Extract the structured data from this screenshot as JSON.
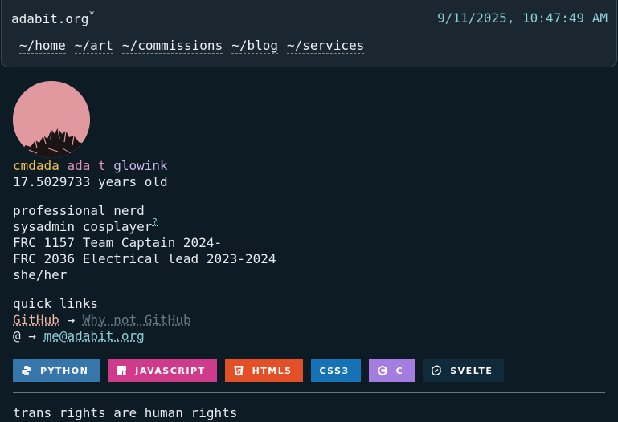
{
  "header": {
    "site_title": "adabit.org",
    "title_star": "*",
    "clock": "9/11/2025, 10:47:49 AM",
    "nav": [
      {
        "label": "~/home"
      },
      {
        "label": "~/art"
      },
      {
        "label": "~/commissions"
      },
      {
        "label": "~/blog"
      },
      {
        "label": "~/services"
      }
    ]
  },
  "profile": {
    "names": [
      "cmdada",
      "ada t",
      "glowink"
    ],
    "age": "17.5029733 years old",
    "bio": [
      "professional nerd",
      "sysadmin cosplayer",
      "FRC 1157 Team Captain 2024-",
      "FRC 2036 Electrical lead 2023-2024",
      "she/her"
    ],
    "bio_footnote": "?"
  },
  "quick_links": {
    "heading": "quick links",
    "github_label": "GitHub",
    "arrow": "→",
    "why_not_github": "Why not GitHub",
    "at": "@",
    "email": "me@adabit.org"
  },
  "badges": [
    {
      "label": "PYTHON",
      "icon": "python-icon",
      "color": "#3776ab"
    },
    {
      "label": "JAVASCRIPT",
      "icon": "javascript-icon",
      "color": "#cf3b8a"
    },
    {
      "label": "HTML5",
      "icon": "html5-icon",
      "color": "#e34f26"
    },
    {
      "label": "CSS3",
      "icon": "css3-icon",
      "color": "#1572b6"
    },
    {
      "label": "C",
      "icon": "c-icon",
      "color": "#a37ee0"
    },
    {
      "label": "SVELTE",
      "icon": "svelte-icon",
      "color": "#0f2a3b"
    }
  ],
  "footer": {
    "text": "trans rights are human rights"
  },
  "colors": {
    "background": "#0d1b24",
    "header_bg": "#1a2731",
    "accent_cyan": "#8ecfd6",
    "name_yellow": "#f2c14e",
    "name_pink": "#e58fb2",
    "name_lavender": "#c7b8e8",
    "avatar_pink": "#e09a9f"
  }
}
